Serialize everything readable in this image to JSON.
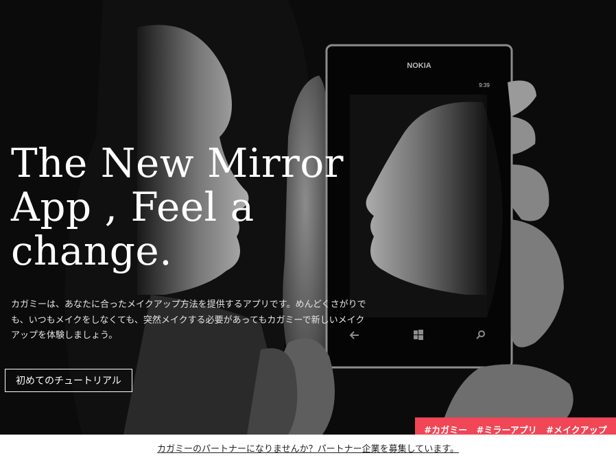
{
  "hero": {
    "headline_lines": [
      "The New Mirror",
      "App , Feel a",
      "change."
    ],
    "description_lines": [
      "カガミーは、あなたに合ったメイクアップ方法を提供するアプリです。めんどくさがりで",
      "も、いつもメイクをしなくても、突然メイクする必要があってもカガミーで新しいメイク",
      "アップを体験しましょう。"
    ],
    "cta_label": "初めてのチュートリアル"
  },
  "phone": {
    "brand": "NOKIA",
    "time": "9:39",
    "icons": [
      "back-arrow-icon",
      "windows-logo-icon",
      "search-icon"
    ]
  },
  "tags": [
    "#カガミー",
    "#ミラーアプリ",
    "#メイクアップ"
  ],
  "footer": {
    "partner_text": "カガミーのパートナーになりませんか？パートナー企業を募集しています。"
  },
  "colors": {
    "hero_background": "#0b0b0b",
    "tag_bar": "#f04655",
    "footer_background": "#ffffff"
  }
}
